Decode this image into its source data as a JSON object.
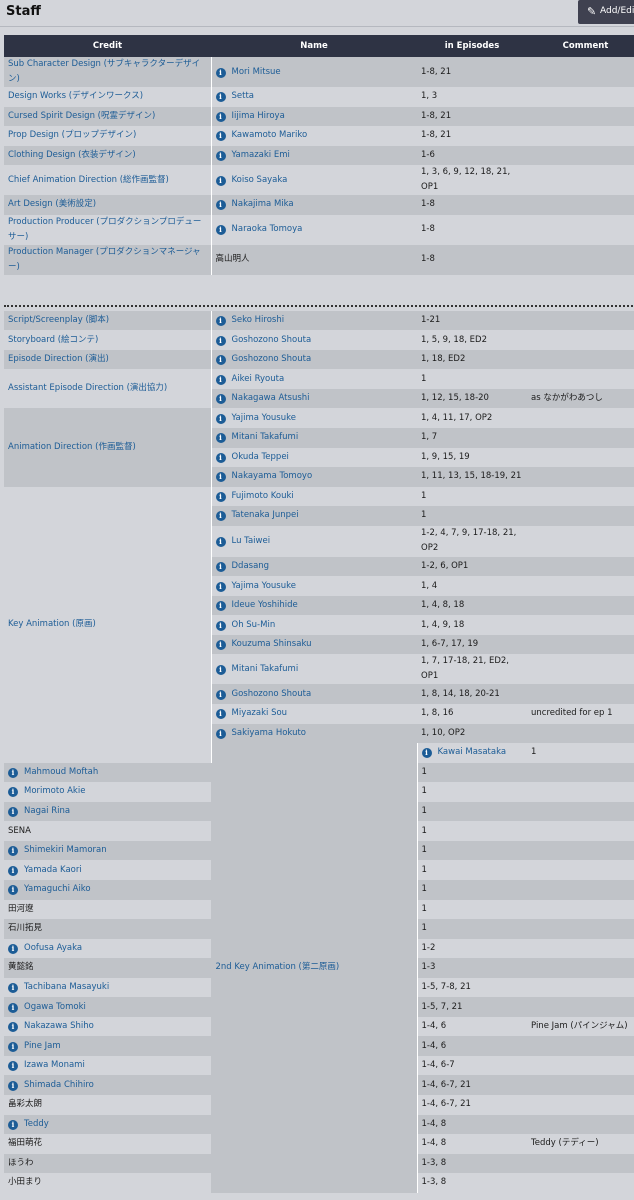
{
  "header": {
    "title": "Staff",
    "add_button": "Add/Edit"
  },
  "columns": [
    "Credit",
    "Name",
    "in Episodes",
    "Comment"
  ],
  "rows": [
    {
      "credit": "Sub Character Design (サブキャラクターデザイン)",
      "span": 1,
      "shade": true,
      "name": "Mori Mitsue",
      "info": true,
      "episodes": "1-8, 21",
      "comment": ""
    },
    {
      "credit": "Design Works (デザインワークス)",
      "span": 1,
      "shade": false,
      "name": "Setta",
      "info": true,
      "episodes": "1, 3",
      "comment": ""
    },
    {
      "credit": "Cursed Spirit Design (呪霊デザイン)",
      "span": 1,
      "shade": true,
      "name": "Iijima Hiroya",
      "info": true,
      "episodes": "1-8, 21",
      "comment": ""
    },
    {
      "credit": "Prop Design (プロップデザイン)",
      "span": 1,
      "shade": false,
      "name": "Kawamoto Mariko",
      "info": true,
      "episodes": "1-8, 21",
      "comment": ""
    },
    {
      "credit": "Clothing Design (衣装デザイン)",
      "span": 1,
      "shade": true,
      "name": "Yamazaki Emi",
      "info": true,
      "episodes": "1-6",
      "comment": ""
    },
    {
      "credit": "Chief Animation Direction (総作画監督)",
      "span": 1,
      "shade": false,
      "name": "Koiso Sayaka",
      "info": true,
      "episodes": "1, 3, 6, 9, 12, 18, 21, OP1",
      "comment": ""
    },
    {
      "credit": "Art Design (美術設定)",
      "span": 1,
      "shade": true,
      "name": "Nakajima Mika",
      "info": true,
      "episodes": "1-8",
      "comment": ""
    },
    {
      "credit": "Production Producer (プロダクションプロデューサー)",
      "span": 1,
      "shade": false,
      "name": "Naraoka Tomoya",
      "info": true,
      "episodes": "1-8",
      "comment": ""
    },
    {
      "credit": "Production Manager (プロダクションマネージャー)",
      "span": 1,
      "shade": true,
      "name": "高山明人",
      "info": false,
      "episodes": "1-8",
      "comment": ""
    },
    {
      "sep": true
    },
    {
      "credit": "Script/Screenplay (脚本)",
      "span": 1,
      "shade": true,
      "name": "Seko Hiroshi",
      "info": true,
      "episodes": "1-21",
      "comment": ""
    },
    {
      "credit": "Storyboard (絵コンテ)",
      "span": 1,
      "shade": false,
      "name": "Goshozono Shouta",
      "info": true,
      "episodes": "1, 5, 9, 18, ED2",
      "comment": ""
    },
    {
      "credit": "Episode Direction (演出)",
      "span": 1,
      "shade": true,
      "name": "Goshozono Shouta",
      "info": true,
      "episodes": "1, 18, ED2",
      "comment": ""
    },
    {
      "credit": "Assistant Episode Direction (演出協力)",
      "span": 2,
      "shade": false,
      "name": "Aikei Ryouta",
      "info": true,
      "episodes": "1",
      "comment": ""
    },
    {
      "name": "Nakagawa Atsushi",
      "info": true,
      "episodes": "1, 12, 15, 18-20",
      "comment": "as なかがわあつし"
    },
    {
      "credit": "Animation Direction (作画監督)",
      "span": 4,
      "shade": true,
      "name": "Yajima Yousuke",
      "info": true,
      "episodes": "1, 4, 11, 17, OP2",
      "comment": ""
    },
    {
      "name": "Mitani Takafumi",
      "info": true,
      "episodes": "1, 7",
      "comment": ""
    },
    {
      "name": "Okuda Teppei",
      "info": true,
      "episodes": "1, 9, 15, 19",
      "comment": ""
    },
    {
      "name": "Nakayama Tomoyo",
      "info": true,
      "episodes": "1, 11, 13, 15, 18-19, 21",
      "comment": ""
    },
    {
      "credit": "Key Animation (原画)",
      "span": 13,
      "shade": false,
      "name": "Fujimoto Kouki",
      "info": true,
      "episodes": "1",
      "comment": ""
    },
    {
      "name": "Tatenaka Junpei",
      "info": true,
      "episodes": "1",
      "comment": ""
    },
    {
      "name": "Lu Taiwei",
      "info": true,
      "episodes": "1-2, 4, 7, 9, 17-18, 21, OP2",
      "comment": "",
      "tall": true
    },
    {
      "name": "Ddasang",
      "info": true,
      "episodes": "1-2, 6, OP1",
      "comment": ""
    },
    {
      "name": "Yajima Yousuke",
      "info": true,
      "episodes": "1, 4",
      "comment": ""
    },
    {
      "name": "Ideue Yoshihide",
      "info": true,
      "episodes": "1, 4, 8, 18",
      "comment": ""
    },
    {
      "name": "Oh Su-Min",
      "info": true,
      "episodes": "1, 4, 9, 18",
      "comment": ""
    },
    {
      "name": "Kouzuma Shinsaku",
      "info": true,
      "episodes": "1, 6-7, 17, 19",
      "comment": ""
    },
    {
      "name": "Mitani Takafumi",
      "info": true,
      "episodes": "1, 7, 17-18, 21, ED2, OP1",
      "comment": ""
    },
    {
      "name": "Goshozono Shouta",
      "info": true,
      "episodes": "1, 8, 14, 18, 20-21",
      "comment": ""
    },
    {
      "name": "Miyazaki Sou",
      "info": true,
      "episodes": "1, 8, 16",
      "comment": "uncredited for ep 1"
    },
    {
      "name": "Sakiyama Hokuto",
      "info": true,
      "episodes": "1, 10, OP2",
      "comment": ""
    },
    {
      "credit": "2nd Key Animation (第二原画)",
      "span": 23,
      "shade": true,
      "name": "Kawai Masataka",
      "info": true,
      "episodes": "1",
      "comment": ""
    },
    {
      "name": "Mahmoud Moftah",
      "info": true,
      "episodes": "1",
      "comment": ""
    },
    {
      "name": "Morimoto Akie",
      "info": true,
      "episodes": "1",
      "comment": ""
    },
    {
      "name": "Nagai Rina",
      "info": true,
      "episodes": "1",
      "comment": ""
    },
    {
      "name": "SENA",
      "info": false,
      "episodes": "1",
      "comment": ""
    },
    {
      "name": "Shimekiri Mamoran",
      "info": true,
      "episodes": "1",
      "comment": ""
    },
    {
      "name": "Yamada Kaori",
      "info": true,
      "episodes": "1",
      "comment": ""
    },
    {
      "name": "Yamaguchi Aiko",
      "info": true,
      "episodes": "1",
      "comment": ""
    },
    {
      "name": "田河遼",
      "info": false,
      "episodes": "1",
      "comment": ""
    },
    {
      "name": "石川拓見",
      "info": false,
      "episodes": "1",
      "comment": ""
    },
    {
      "name": "Oofusa Ayaka",
      "info": true,
      "episodes": "1-2",
      "comment": ""
    },
    {
      "name": "黄懿銘",
      "info": false,
      "episodes": "1-3",
      "comment": ""
    },
    {
      "name": "Tachibana Masayuki",
      "info": true,
      "episodes": "1-5, 7-8, 21",
      "comment": ""
    },
    {
      "name": "Ogawa Tomoki",
      "info": true,
      "episodes": "1-5, 7, 21",
      "comment": ""
    },
    {
      "name": "Nakazawa Shiho",
      "info": true,
      "episodes": "1-4, 6",
      "comment": "Pine Jam (パインジャム)"
    },
    {
      "name": "Pine Jam",
      "info": true,
      "episodes": "1-4, 6",
      "comment": ""
    },
    {
      "name": "Izawa Monami",
      "info": true,
      "episodes": "1-4, 6-7",
      "comment": ""
    },
    {
      "name": "Shimada Chihiro",
      "info": true,
      "episodes": "1-4, 6-7, 21",
      "comment": ""
    },
    {
      "name": "畠彩太朗",
      "info": false,
      "episodes": "1-4, 6-7, 21",
      "comment": ""
    },
    {
      "name": "Teddy",
      "info": true,
      "episodes": "1-4, 8",
      "comment": ""
    },
    {
      "name": "福田萌花",
      "info": false,
      "episodes": "1-4, 8",
      "comment": "Teddy (テディー)"
    },
    {
      "name": "ほうわ",
      "info": false,
      "episodes": "1-3, 8",
      "comment": ""
    },
    {
      "name": "小田まり",
      "info": false,
      "episodes": "1-3, 8",
      "comment": ""
    }
  ]
}
